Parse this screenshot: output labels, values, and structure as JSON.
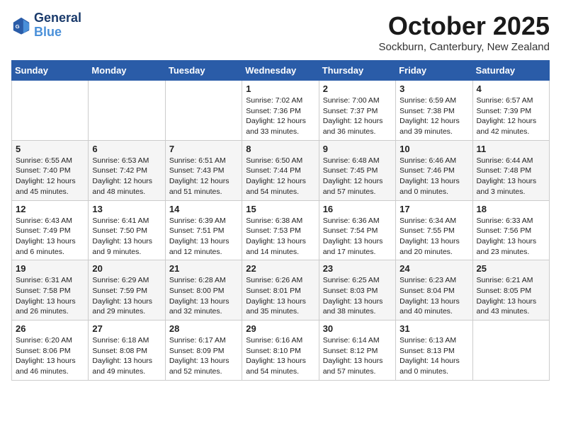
{
  "header": {
    "logo_line1": "General",
    "logo_line2": "Blue",
    "month": "October 2025",
    "location": "Sockburn, Canterbury, New Zealand"
  },
  "weekdays": [
    "Sunday",
    "Monday",
    "Tuesday",
    "Wednesday",
    "Thursday",
    "Friday",
    "Saturday"
  ],
  "weeks": [
    [
      {
        "num": "",
        "info": ""
      },
      {
        "num": "",
        "info": ""
      },
      {
        "num": "",
        "info": ""
      },
      {
        "num": "1",
        "info": "Sunrise: 7:02 AM\nSunset: 7:36 PM\nDaylight: 12 hours\nand 33 minutes."
      },
      {
        "num": "2",
        "info": "Sunrise: 7:00 AM\nSunset: 7:37 PM\nDaylight: 12 hours\nand 36 minutes."
      },
      {
        "num": "3",
        "info": "Sunrise: 6:59 AM\nSunset: 7:38 PM\nDaylight: 12 hours\nand 39 minutes."
      },
      {
        "num": "4",
        "info": "Sunrise: 6:57 AM\nSunset: 7:39 PM\nDaylight: 12 hours\nand 42 minutes."
      }
    ],
    [
      {
        "num": "5",
        "info": "Sunrise: 6:55 AM\nSunset: 7:40 PM\nDaylight: 12 hours\nand 45 minutes."
      },
      {
        "num": "6",
        "info": "Sunrise: 6:53 AM\nSunset: 7:42 PM\nDaylight: 12 hours\nand 48 minutes."
      },
      {
        "num": "7",
        "info": "Sunrise: 6:51 AM\nSunset: 7:43 PM\nDaylight: 12 hours\nand 51 minutes."
      },
      {
        "num": "8",
        "info": "Sunrise: 6:50 AM\nSunset: 7:44 PM\nDaylight: 12 hours\nand 54 minutes."
      },
      {
        "num": "9",
        "info": "Sunrise: 6:48 AM\nSunset: 7:45 PM\nDaylight: 12 hours\nand 57 minutes."
      },
      {
        "num": "10",
        "info": "Sunrise: 6:46 AM\nSunset: 7:46 PM\nDaylight: 13 hours\nand 0 minutes."
      },
      {
        "num": "11",
        "info": "Sunrise: 6:44 AM\nSunset: 7:48 PM\nDaylight: 13 hours\nand 3 minutes."
      }
    ],
    [
      {
        "num": "12",
        "info": "Sunrise: 6:43 AM\nSunset: 7:49 PM\nDaylight: 13 hours\nand 6 minutes."
      },
      {
        "num": "13",
        "info": "Sunrise: 6:41 AM\nSunset: 7:50 PM\nDaylight: 13 hours\nand 9 minutes."
      },
      {
        "num": "14",
        "info": "Sunrise: 6:39 AM\nSunset: 7:51 PM\nDaylight: 13 hours\nand 12 minutes."
      },
      {
        "num": "15",
        "info": "Sunrise: 6:38 AM\nSunset: 7:53 PM\nDaylight: 13 hours\nand 14 minutes."
      },
      {
        "num": "16",
        "info": "Sunrise: 6:36 AM\nSunset: 7:54 PM\nDaylight: 13 hours\nand 17 minutes."
      },
      {
        "num": "17",
        "info": "Sunrise: 6:34 AM\nSunset: 7:55 PM\nDaylight: 13 hours\nand 20 minutes."
      },
      {
        "num": "18",
        "info": "Sunrise: 6:33 AM\nSunset: 7:56 PM\nDaylight: 13 hours\nand 23 minutes."
      }
    ],
    [
      {
        "num": "19",
        "info": "Sunrise: 6:31 AM\nSunset: 7:58 PM\nDaylight: 13 hours\nand 26 minutes."
      },
      {
        "num": "20",
        "info": "Sunrise: 6:29 AM\nSunset: 7:59 PM\nDaylight: 13 hours\nand 29 minutes."
      },
      {
        "num": "21",
        "info": "Sunrise: 6:28 AM\nSunset: 8:00 PM\nDaylight: 13 hours\nand 32 minutes."
      },
      {
        "num": "22",
        "info": "Sunrise: 6:26 AM\nSunset: 8:01 PM\nDaylight: 13 hours\nand 35 minutes."
      },
      {
        "num": "23",
        "info": "Sunrise: 6:25 AM\nSunset: 8:03 PM\nDaylight: 13 hours\nand 38 minutes."
      },
      {
        "num": "24",
        "info": "Sunrise: 6:23 AM\nSunset: 8:04 PM\nDaylight: 13 hours\nand 40 minutes."
      },
      {
        "num": "25",
        "info": "Sunrise: 6:21 AM\nSunset: 8:05 PM\nDaylight: 13 hours\nand 43 minutes."
      }
    ],
    [
      {
        "num": "26",
        "info": "Sunrise: 6:20 AM\nSunset: 8:06 PM\nDaylight: 13 hours\nand 46 minutes."
      },
      {
        "num": "27",
        "info": "Sunrise: 6:18 AM\nSunset: 8:08 PM\nDaylight: 13 hours\nand 49 minutes."
      },
      {
        "num": "28",
        "info": "Sunrise: 6:17 AM\nSunset: 8:09 PM\nDaylight: 13 hours\nand 52 minutes."
      },
      {
        "num": "29",
        "info": "Sunrise: 6:16 AM\nSunset: 8:10 PM\nDaylight: 13 hours\nand 54 minutes."
      },
      {
        "num": "30",
        "info": "Sunrise: 6:14 AM\nSunset: 8:12 PM\nDaylight: 13 hours\nand 57 minutes."
      },
      {
        "num": "31",
        "info": "Sunrise: 6:13 AM\nSunset: 8:13 PM\nDaylight: 14 hours\nand 0 minutes."
      },
      {
        "num": "",
        "info": ""
      }
    ]
  ]
}
